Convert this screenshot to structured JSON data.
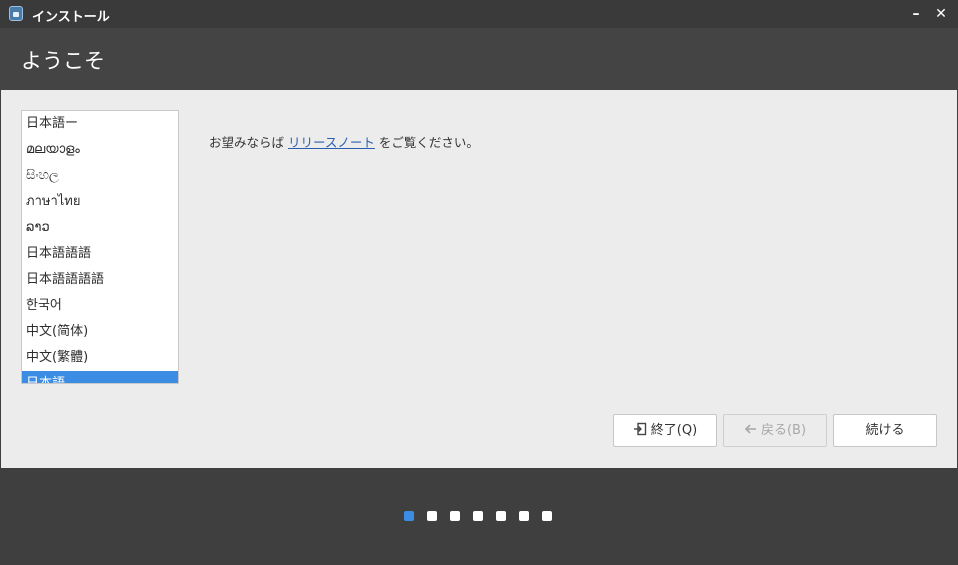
{
  "window": {
    "title": "インストール",
    "minimize_label": "–",
    "close_label": "✕"
  },
  "header": {
    "title": "ようこそ"
  },
  "languages": {
    "items": [
      "日本語ー",
      "മലയാളം",
      "සිංහල",
      "ภาษาไทย",
      "ລາວ",
      "日本語語語",
      "日本語語語語",
      "한국어",
      "中文(简体)",
      "中文(繁體)",
      "日本語"
    ],
    "selected": "日本語"
  },
  "release_notes": {
    "prefix": "お望みならば ",
    "link": "リリースノート",
    "suffix": " をご覧ください。"
  },
  "buttons": {
    "quit": {
      "label": "終了(Q)",
      "icon": "exit-icon"
    },
    "back": {
      "label": "戻る(B)",
      "icon": "arrow-left-icon"
    },
    "continue": {
      "label": "続ける"
    }
  },
  "progress": {
    "total_steps": 7,
    "current_step": 1
  },
  "colors": {
    "accent": "#3b8de4",
    "header_bg": "#444444",
    "content_bg": "#ececec"
  }
}
